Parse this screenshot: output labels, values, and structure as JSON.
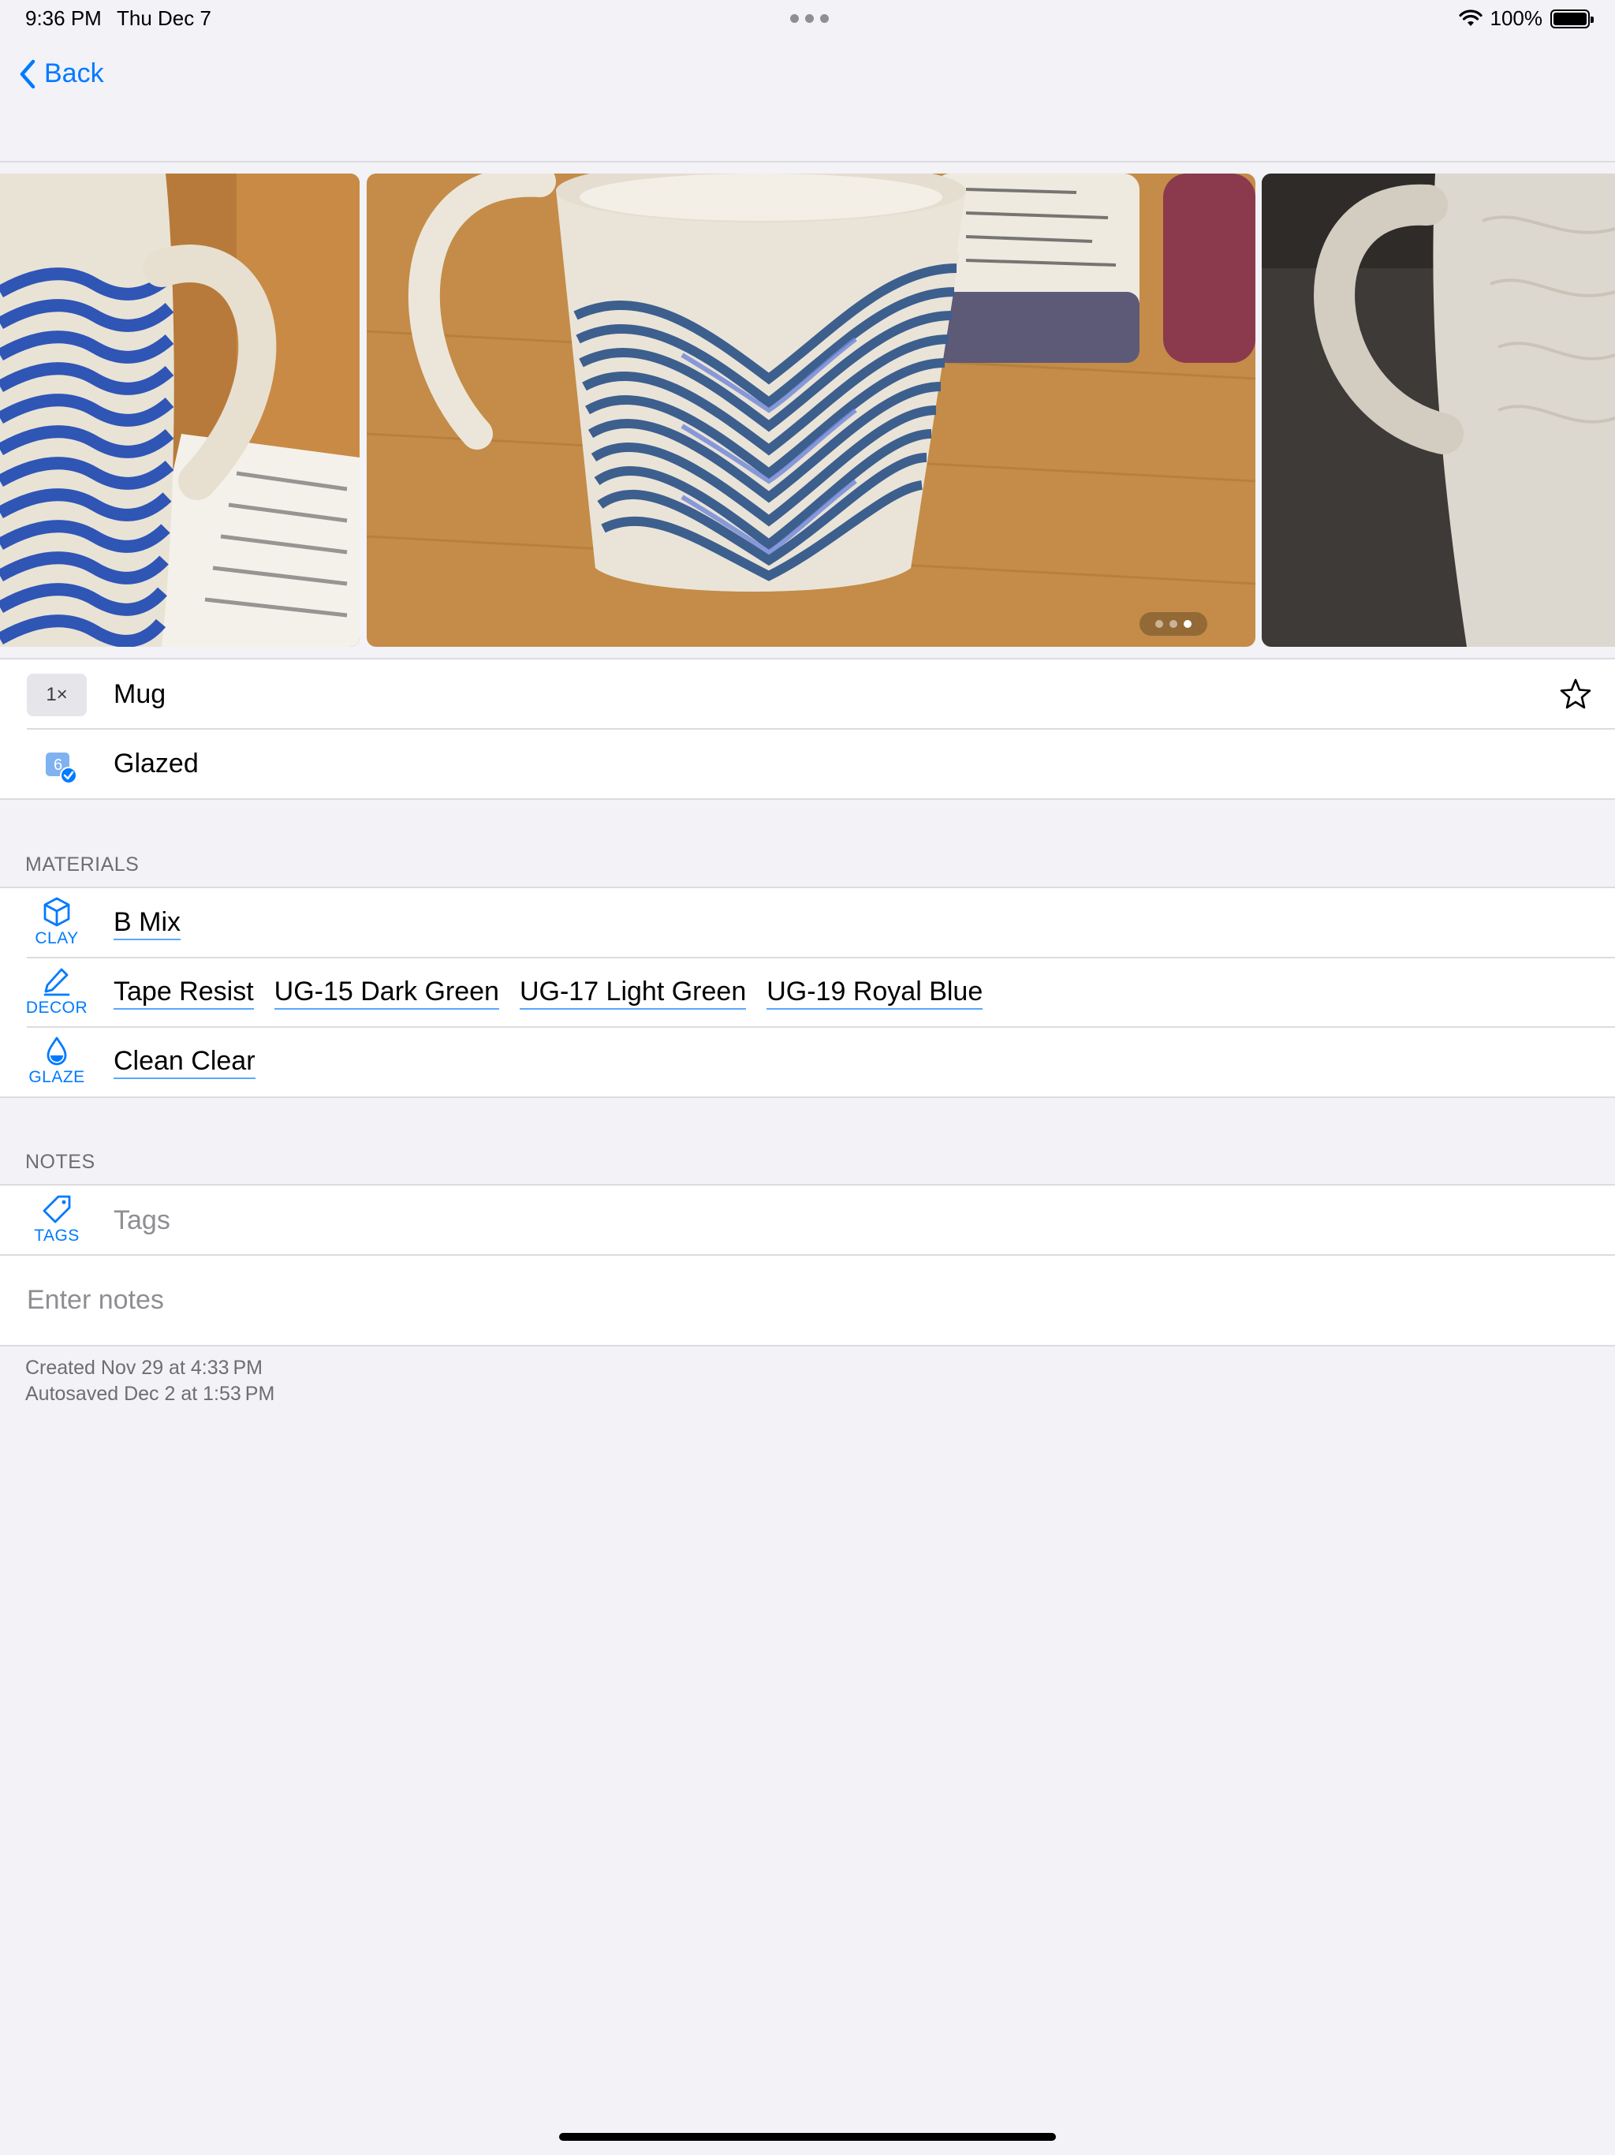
{
  "status_bar": {
    "time": "9:36 PM",
    "date": "Thu Dec 7",
    "battery": "100%"
  },
  "nav": {
    "back_label": "Back"
  },
  "gallery": {
    "photo_count": 3,
    "current_page": 3
  },
  "piece": {
    "quantity": "1×",
    "name": "Mug",
    "stage": "Glazed",
    "stage_badge": "6",
    "favorite": false
  },
  "materials": {
    "header": "MATERIALS",
    "clay": {
      "label": "CLAY",
      "icon": "cube-icon",
      "items": [
        "B Mix"
      ]
    },
    "decor": {
      "label": "DECOR",
      "icon": "pencil-icon",
      "items": [
        "Tape Resist",
        "UG-15 Dark Green",
        "UG-17 Light Green",
        "UG-19 Royal Blue"
      ]
    },
    "glaze": {
      "label": "GLAZE",
      "icon": "drop-icon",
      "items": [
        "Clean Clear"
      ]
    }
  },
  "notes": {
    "header": "NOTES",
    "tags_label": "TAGS",
    "tags_placeholder": "Tags",
    "notes_placeholder": "Enter notes"
  },
  "meta": {
    "created": "Created Nov 29 at 4:33 PM",
    "autosaved": "Autosaved Dec 2 at 1:53 PM"
  },
  "colors": {
    "accent": "#007aff",
    "background": "#f2f2f7",
    "secondary_text": "#6d6d72",
    "placeholder": "#8e8e93"
  }
}
